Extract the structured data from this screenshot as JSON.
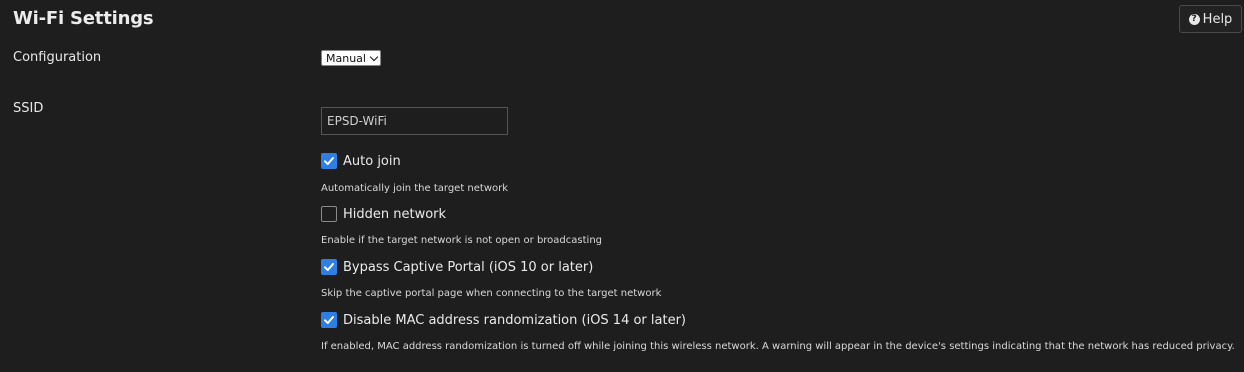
{
  "header": {
    "title": "Wi-Fi Settings",
    "help_label": "Help"
  },
  "configuration": {
    "label": "Configuration",
    "selected": "Manual"
  },
  "ssid": {
    "label": "SSID",
    "value": "EPSD-WiFi"
  },
  "options": [
    {
      "label": "Auto join",
      "checked": true,
      "hint": "Automatically join the target network"
    },
    {
      "label": "Hidden network",
      "checked": false,
      "hint": "Enable if the target network is not open or broadcasting"
    },
    {
      "label": "Bypass Captive Portal (iOS 10 or later)",
      "checked": true,
      "hint": "Skip the captive portal page when connecting to the target network"
    },
    {
      "label": "Disable MAC address randomization (iOS 14 or later)",
      "checked": true,
      "hint": "If enabled, MAC address randomization is turned off while joining this wireless network. A warning will appear in the device's settings indicating that the network has reduced privacy."
    }
  ],
  "colors": {
    "background": "#1e1e1e",
    "checkbox_accent": "#2f7fe3"
  }
}
